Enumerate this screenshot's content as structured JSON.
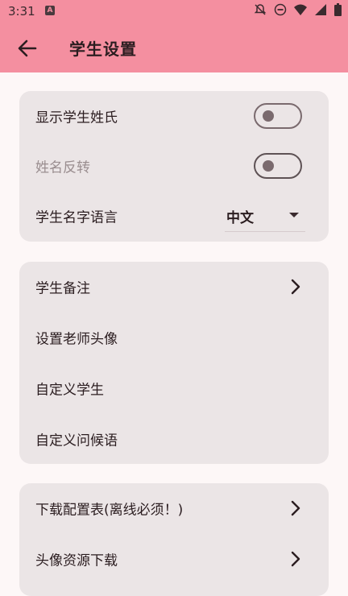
{
  "status_bar": {
    "time": "3:31",
    "app_badge": "A",
    "icons": [
      "notifications-off-icon",
      "dnd-icon",
      "wifi-icon",
      "signal-icon",
      "battery-icon"
    ]
  },
  "app_bar": {
    "title": "学生设置",
    "back_icon": "arrow-left-icon"
  },
  "card1": {
    "show_surname": {
      "label": "显示学生姓氏",
      "checked": false
    },
    "name_reverse": {
      "label": "姓名反转",
      "checked": false,
      "disabled": true
    },
    "name_language": {
      "label": "学生名字语言",
      "value": "中文"
    }
  },
  "card2": {
    "items": [
      {
        "label": "学生备注",
        "has_chevron": true
      },
      {
        "label": "设置老师头像"
      },
      {
        "label": "自定义学生"
      },
      {
        "label": "自定义问候语"
      }
    ]
  },
  "card3": {
    "items": [
      {
        "label": "下载配置表(离线必须！)",
        "has_chevron": true
      },
      {
        "label": "头像资源下载",
        "has_chevron": true
      }
    ]
  },
  "colors": {
    "accent": "#f48fa0",
    "card_bg": "#ebe5e6",
    "page_bg": "#fdf7f7"
  }
}
